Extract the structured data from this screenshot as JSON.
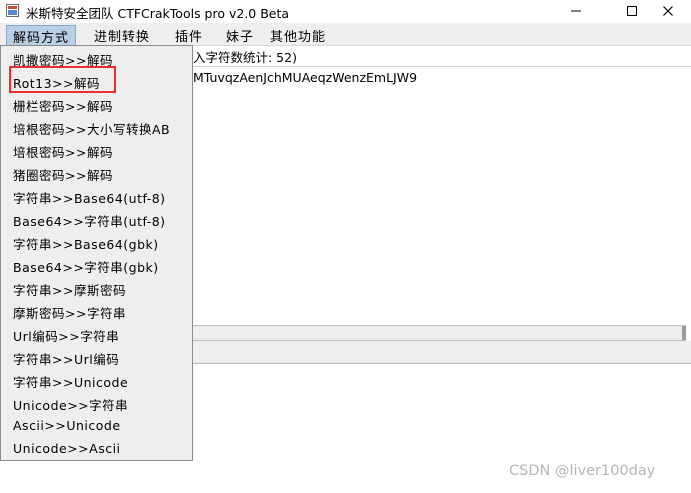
{
  "window": {
    "title": "米斯特安全团队 CTFCrakTools pro v2.0 Beta",
    "minimize_glyph": "—",
    "maximize_glyph": "☐",
    "close_glyph": "✕",
    "icon": "app-icon"
  },
  "menubar": {
    "items": [
      {
        "label": "解码方式"
      },
      {
        "label": "进制转换"
      },
      {
        "label": "插件"
      },
      {
        "label": "妹子"
      },
      {
        "label": "其他功能"
      }
    ]
  },
  "panel": {
    "label": "入字符数统计: 52)",
    "text": "MTuvqzAenJchMUAeqzWenzEmLJW9"
  },
  "dropdown": {
    "items": [
      {
        "label": "凯撒密码>>解码"
      },
      {
        "label": "Rot13>>解码"
      },
      {
        "label": "栅栏密码>>解码"
      },
      {
        "label": "培根密码>>大小写转换AB"
      },
      {
        "label": "培根密码>>解码"
      },
      {
        "label": "猪圈密码>>解码"
      },
      {
        "label": "字符串>>Base64(utf-8)"
      },
      {
        "label": "Base64>>字符串(utf-8)"
      },
      {
        "label": "字符串>>Base64(gbk)"
      },
      {
        "label": "Base64>>字符串(gbk)"
      },
      {
        "label": "字符串>>摩斯密码"
      },
      {
        "label": "摩斯密码>>字符串"
      },
      {
        "label": "Url编码>>字符串"
      },
      {
        "label": "字符串>>Url编码"
      },
      {
        "label": "字符串>>Unicode"
      },
      {
        "label": "Unicode>>字符串"
      },
      {
        "label": "Ascii>>Unicode"
      },
      {
        "label": "Unicode>>Ascii"
      }
    ]
  },
  "watermark": "CSDN @liver100day",
  "colors": {
    "highlight": "#e8312f",
    "menu_active": "#b8cfe5"
  }
}
